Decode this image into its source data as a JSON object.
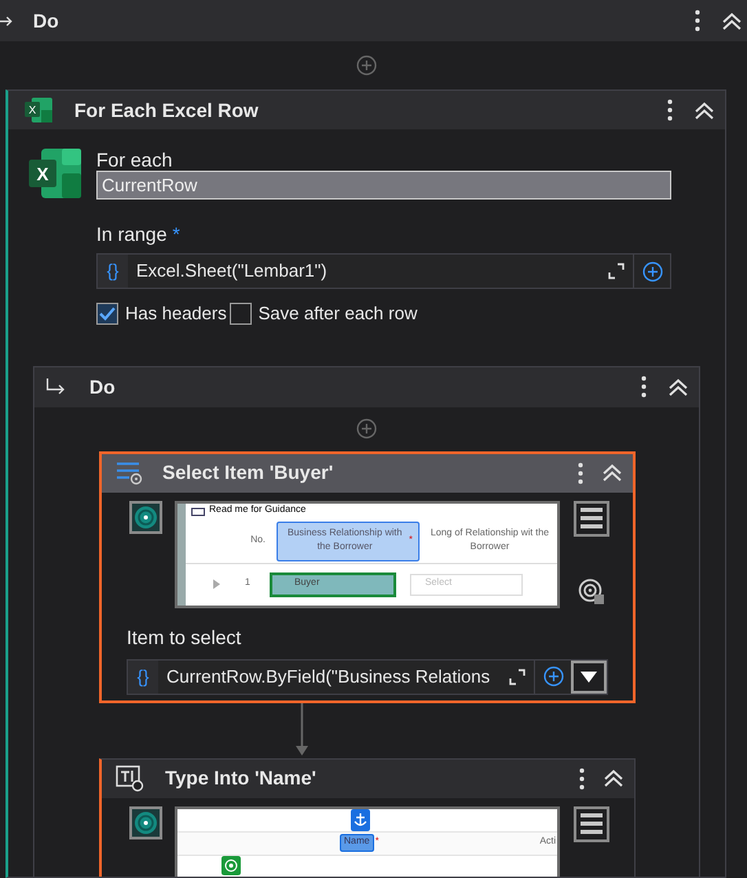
{
  "outer_sequence": {
    "title": "Do"
  },
  "for_each_excel_row": {
    "title": "For Each Excel Row",
    "header_logo_letter": "X",
    "logo_letter": "X",
    "for_each_label": "For each",
    "for_each_value": "CurrentRow",
    "in_range_label": "In range",
    "required_mark": "*",
    "in_range_prefix": "{}",
    "in_range_value": "Excel.Sheet(\"Lembar1\")",
    "options": [
      {
        "label": "Has headers",
        "checked": true
      },
      {
        "label": "Save after each row",
        "checked": false
      }
    ]
  },
  "inner_sequence": {
    "title": "Do"
  },
  "activities": [
    {
      "kind": "select_item",
      "title": "Select Item 'Buyer'",
      "selected": true,
      "preview": {
        "banner": "Read me for Guidance",
        "columns": [
          "No.",
          "Business Relationship with the Borrower",
          "Long of Relationship wit the Borrower"
        ],
        "required_mark": "*",
        "row_number": "1",
        "value": "Buyer",
        "placeholder": "Select"
      },
      "item_label": "Item to select",
      "item_prefix": "{}",
      "item_value": "CurrentRow.ByField(\"Business Relations"
    },
    {
      "kind": "type_into",
      "title": "Type Into 'Name'",
      "selected": false,
      "preview": {
        "column": "Name",
        "required_mark": "*",
        "next_column": "Acti"
      }
    }
  ]
}
